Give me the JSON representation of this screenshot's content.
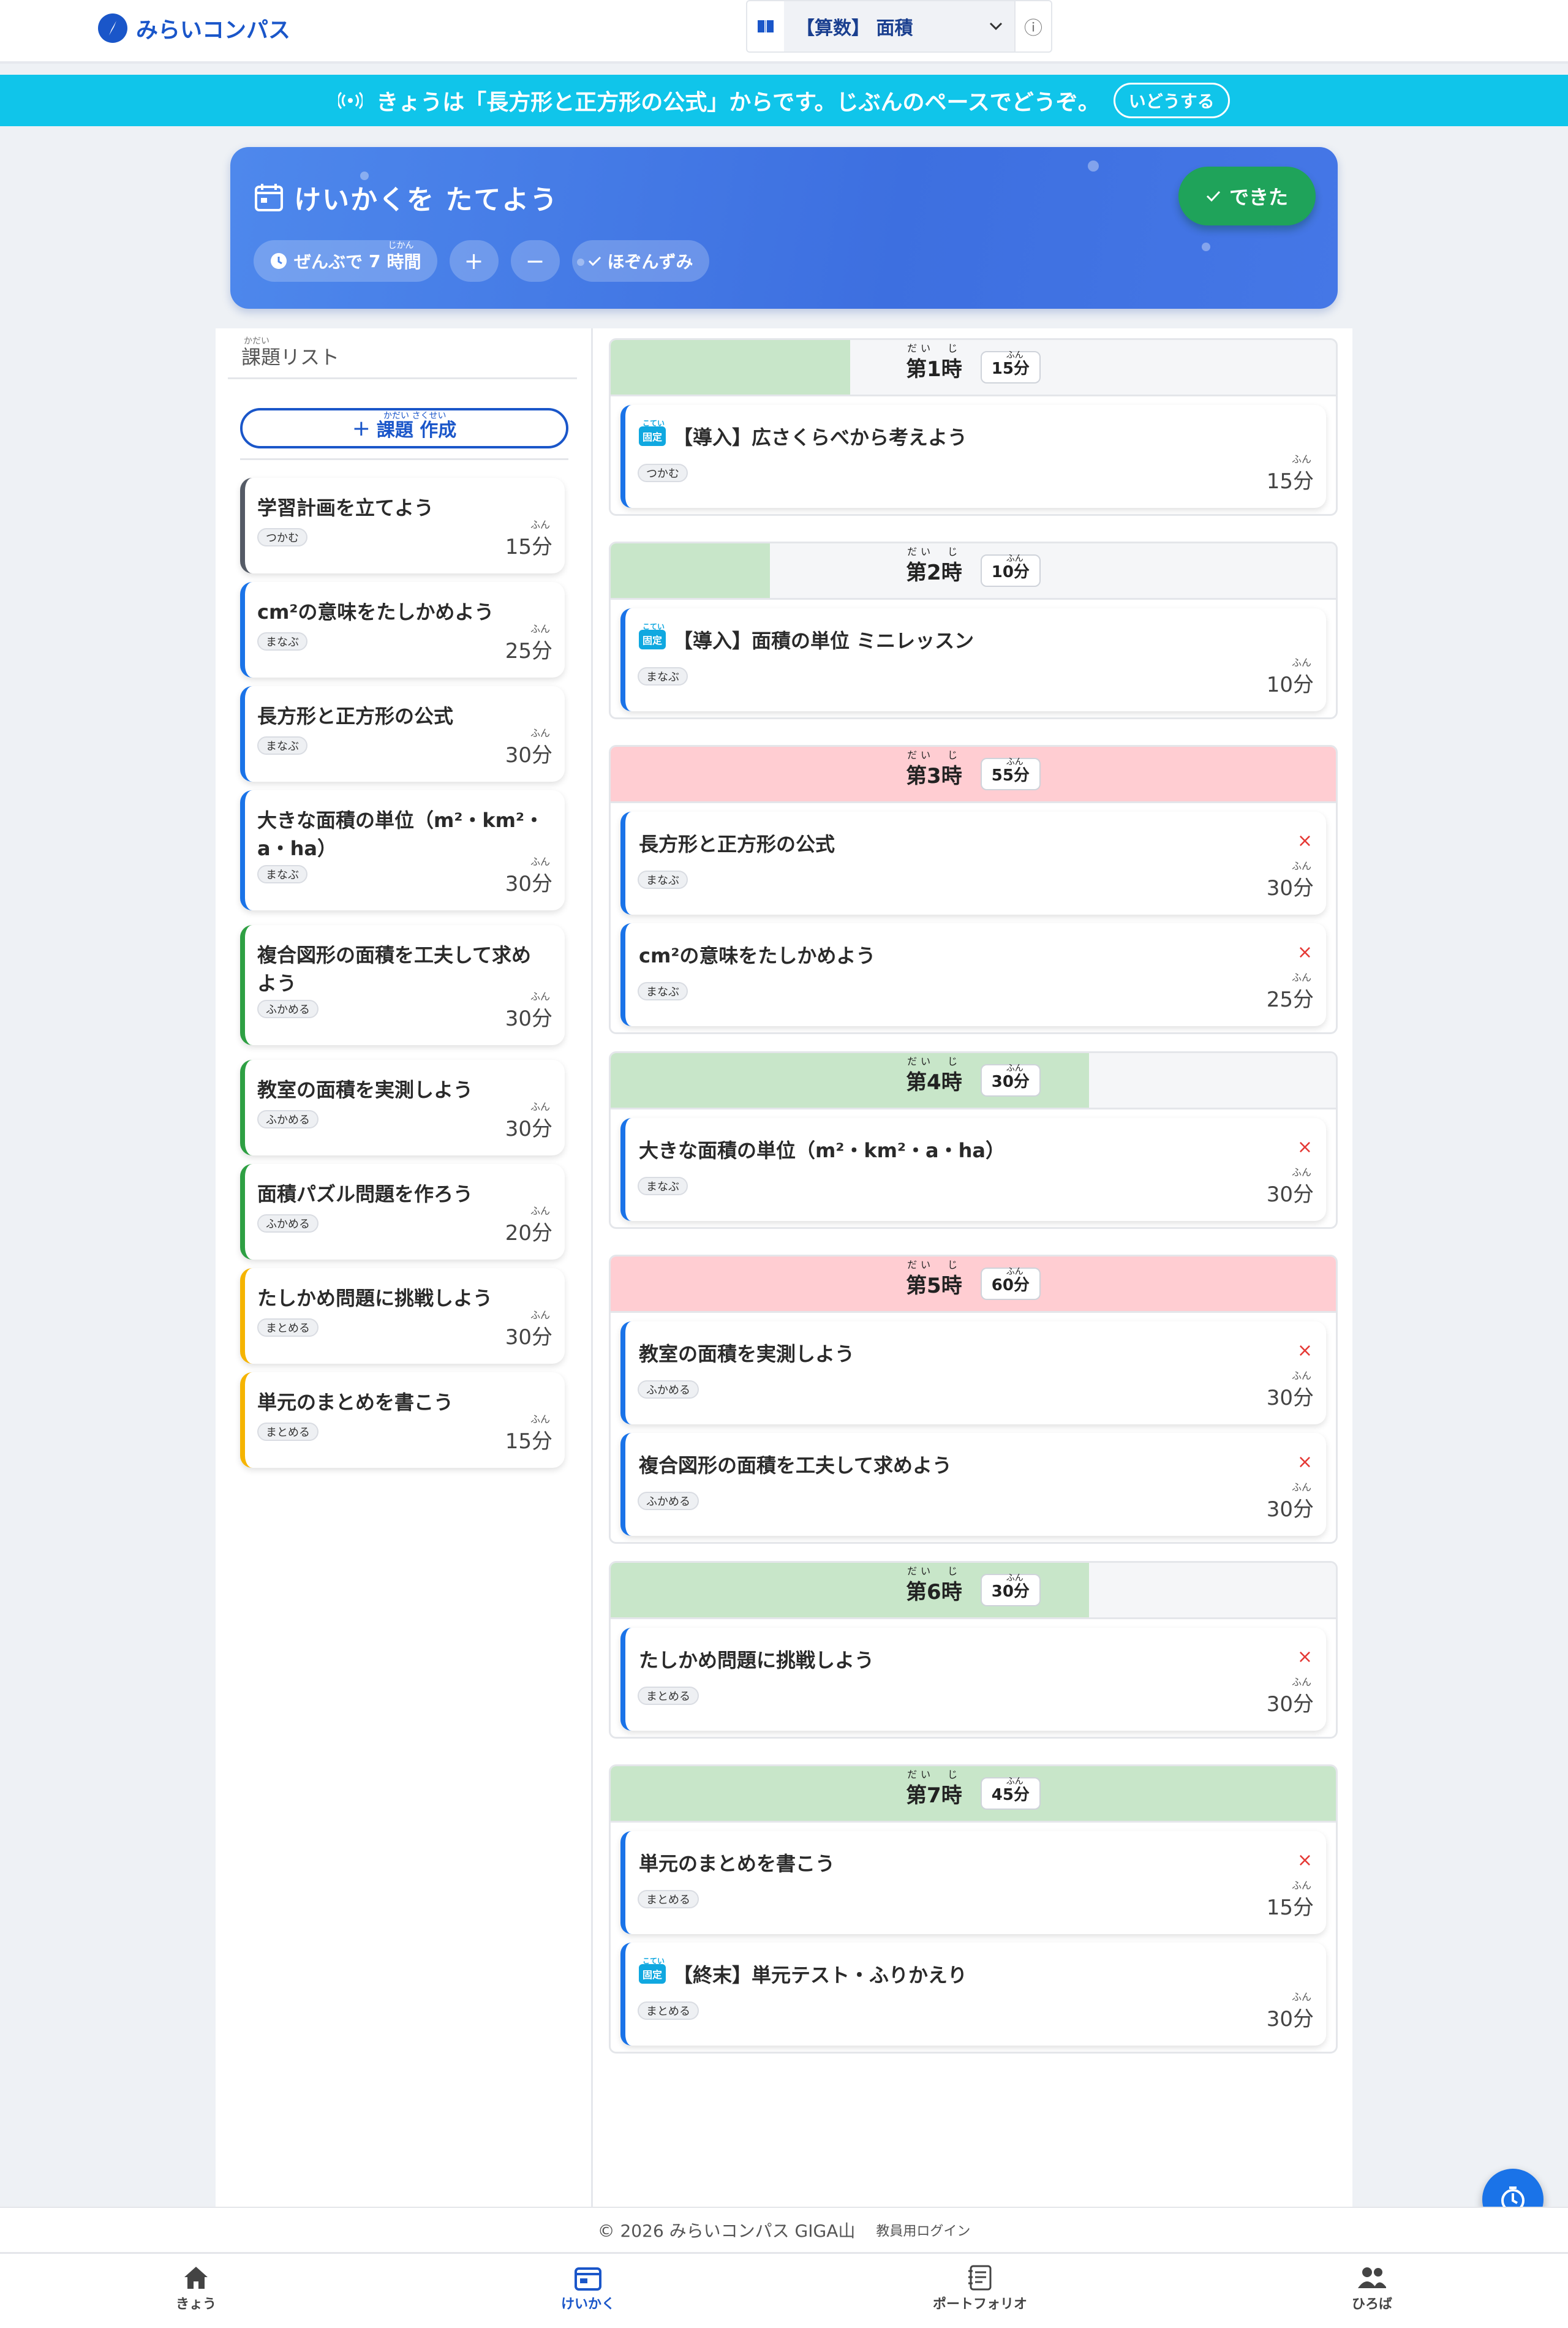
{
  "app": {
    "name": "みらいコンパス"
  },
  "unit_selector": {
    "value": "【算数】 面積",
    "info": "ⓘ"
  },
  "banner": {
    "text": "きょうは「長方形と正方形の公式」からです。じぶんのペースでどうぞ。",
    "button": "いどうする"
  },
  "plan": {
    "title": "けいかくを たてよう",
    "total_prefix": "ぜんぶで",
    "total_hours": "7",
    "hours_unit": "時間",
    "hours_ruby": "じかん",
    "plus": "+",
    "minus": "−",
    "saved": "ほぞんずみ",
    "done": "できた"
  },
  "sidebar": {
    "heading": "課題リスト",
    "heading_ruby": "かだい",
    "create_label": "課題 作成",
    "create_ruby": "かだい さくせい",
    "min_ruby": "ふん",
    "tasks": [
      {
        "title": "学習計画を立てよう",
        "tag": "つかむ",
        "minutes": "15分"
      },
      {
        "title": "cm²の意味をたしかめよう",
        "tag": "まなぶ",
        "minutes": "25分"
      },
      {
        "title": "長方形と正方形の公式",
        "tag": "まなぶ",
        "minutes": "30分"
      },
      {
        "title": "大きな面積の単位（m²・km²・a・ha）",
        "tag": "まなぶ",
        "minutes": "30分"
      },
      {
        "title": "複合図形の面積を工夫して求めよう",
        "tag": "ふかめる",
        "minutes": "30分"
      },
      {
        "title": "教室の面積を実測しよう",
        "tag": "ふかめる",
        "minutes": "30分"
      },
      {
        "title": "面積パズル問題を作ろう",
        "tag": "ふかめる",
        "minutes": "20分"
      },
      {
        "title": "たしかめ問題に挑戦しよう",
        "tag": "まとめる",
        "minutes": "30分"
      },
      {
        "title": "単元のまとめを書こう",
        "tag": "まとめる",
        "minutes": "15分"
      }
    ]
  },
  "periods_ruby": {
    "dai": "だい　じ",
    "fun": "ふん",
    "fixed": "こてい",
    "remove": "×",
    "fixed_label": "固定"
  },
  "periods": [
    {
      "label": "第1時",
      "minutes": "15分",
      "progress": 0.33,
      "over": false,
      "items": [
        {
          "title": "【導入】広さくらべから考えよう",
          "tag": "つかむ",
          "minutes": "15分",
          "fixed": true
        }
      ]
    },
    {
      "label": "第2時",
      "minutes": "10分",
      "progress": 0.22,
      "over": false,
      "items": [
        {
          "title": "【導入】面積の単位 ミニレッスン",
          "tag": "まなぶ",
          "minutes": "10分",
          "fixed": true
        }
      ]
    },
    {
      "label": "第3時",
      "minutes": "55分",
      "progress": 1.0,
      "over": true,
      "items": [
        {
          "title": "長方形と正方形の公式",
          "tag": "まなぶ",
          "minutes": "30分",
          "fixed": false
        },
        {
          "title": "cm²の意味をたしかめよう",
          "tag": "まなぶ",
          "minutes": "25分",
          "fixed": false
        }
      ]
    },
    {
      "label": "第4時",
      "minutes": "30分",
      "progress": 0.66,
      "over": false,
      "items": [
        {
          "title": "大きな面積の単位（m²・km²・a・ha）",
          "tag": "まなぶ",
          "minutes": "30分",
          "fixed": false
        }
      ]
    },
    {
      "label": "第5時",
      "minutes": "60分",
      "progress": 1.0,
      "over": true,
      "items": [
        {
          "title": "教室の面積を実測しよう",
          "tag": "ふかめる",
          "minutes": "30分",
          "fixed": false
        },
        {
          "title": "複合図形の面積を工夫して求めよう",
          "tag": "ふかめる",
          "minutes": "30分",
          "fixed": false
        }
      ]
    },
    {
      "label": "第6時",
      "minutes": "30分",
      "progress": 0.66,
      "over": false,
      "items": [
        {
          "title": "たしかめ問題に挑戦しよう",
          "tag": "まとめる",
          "minutes": "30分",
          "fixed": false
        }
      ]
    },
    {
      "label": "第7時",
      "minutes": "45分",
      "progress": 1.0,
      "over": false,
      "items": [
        {
          "title": "単元のまとめを書こう",
          "tag": "まとめる",
          "minutes": "15分",
          "fixed": false
        },
        {
          "title": "【終末】単元テスト・ふりかえり",
          "tag": "まとめる",
          "minutes": "30分",
          "fixed": true
        }
      ]
    }
  ],
  "footer": {
    "copyright": "© 2026 みらいコンパス GIGA山",
    "login": "教員用ログイン"
  },
  "nav": [
    {
      "label": "きょう",
      "icon": "home-icon"
    },
    {
      "label": "けいかく",
      "icon": "calendar-icon",
      "active": true
    },
    {
      "label": "ポートフォリオ",
      "icon": "notebook-icon"
    },
    {
      "label": "ひろば",
      "icon": "people-icon"
    }
  ],
  "colors": {
    "brand": "#1a56c9",
    "banner": "#10c5ea",
    "done": "#1fa35a",
    "over": "#ffcdd2",
    "fill": "#c8e6c9",
    "tsukamu": "#555b66",
    "manabu": "#1a73e8",
    "fukameru": "#2ea043",
    "matomeru": "#f5b400"
  }
}
